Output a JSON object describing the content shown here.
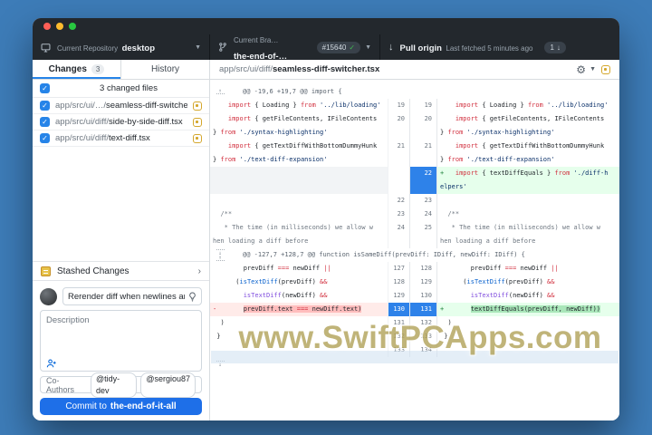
{
  "toolbar": {
    "repository": {
      "label": "Current Repository",
      "value": "desktop"
    },
    "branch": {
      "label": "Current Bra…",
      "value": "the-end-of-…",
      "badge": "#15640"
    },
    "pull": {
      "label": "Pull origin",
      "sublabel": "Last fetched 5 minutes ago",
      "badge": "1"
    }
  },
  "sidebar": {
    "tabs": {
      "changes": "Changes",
      "changes_badge": "3",
      "history": "History"
    },
    "files_header": "3 changed files",
    "files": [
      {
        "prefix": "app/src/ui/…/",
        "name": "seamless-diff-switcher.tsx",
        "checked": true,
        "status": "modified"
      },
      {
        "prefix": "app/src/ui/diff/",
        "name": "side-by-side-diff.tsx",
        "checked": true,
        "status": "modified"
      },
      {
        "prefix": "app/src/ui/diff/",
        "name": "text-diff.tsx",
        "checked": true,
        "status": "modified"
      }
    ],
    "stashed_label": "Stashed Changes",
    "commit": {
      "summary_value": "Rerender diff when newlines are adde",
      "description_placeholder": "Description",
      "coauthors_label": "Co-Authors",
      "coauthors": [
        "@tidy-dev",
        "@sergiou87"
      ],
      "button_prefix": "Commit to",
      "button_branch": "the-end-of-it-all"
    }
  },
  "diff": {
    "path_prefix": "app/src/ui/diff/",
    "file_name": "seamless-diff-switcher.tsx",
    "rows": [
      {
        "t": "hunk",
        "icons": [
          "up"
        ],
        "text": "@@ -19,6 +19,7 @@ import {"
      },
      {
        "t": "line",
        "old": "19",
        "new": "19",
        "lk": "ctx",
        "rk": "ctx",
        "l": [
          [
            "    ",
            "p"
          ],
          [
            "import",
            "k"
          ],
          [
            " { Loading } ",
            "p"
          ],
          [
            "from",
            "k"
          ],
          [
            " ",
            "p"
          ],
          [
            "'../lib/loading'",
            "s"
          ]
        ],
        "r": [
          [
            "    ",
            "p"
          ],
          [
            "import",
            "k"
          ],
          [
            " { Loading } ",
            "p"
          ],
          [
            "from",
            "k"
          ],
          [
            " ",
            "p"
          ],
          [
            "'../lib/loading'",
            "s"
          ]
        ]
      },
      {
        "t": "line",
        "old": "20",
        "new": "20",
        "lk": "ctx",
        "rk": "ctx",
        "l": [
          [
            "    ",
            "p"
          ],
          [
            "import",
            "k"
          ],
          [
            " { getFileContents, IFileContents\n} ",
            "p"
          ],
          [
            "from",
            "k"
          ],
          [
            " ",
            "p"
          ],
          [
            "'./syntax-highlighting'",
            "s"
          ]
        ],
        "r": [
          [
            "    ",
            "p"
          ],
          [
            "import",
            "k"
          ],
          [
            " { getFileContents, IFileContents\n} ",
            "p"
          ],
          [
            "from",
            "k"
          ],
          [
            " ",
            "p"
          ],
          [
            "'./syntax-highlighting'",
            "s"
          ]
        ]
      },
      {
        "t": "line",
        "old": "21",
        "new": "21",
        "lk": "ctx",
        "rk": "ctx",
        "l": [
          [
            "    ",
            "p"
          ],
          [
            "import",
            "k"
          ],
          [
            " { getTextDiffWithBottomDummyHunk\n} ",
            "p"
          ],
          [
            "from",
            "k"
          ],
          [
            " ",
            "p"
          ],
          [
            "'./text-diff-expansion'",
            "s"
          ]
        ],
        "r": [
          [
            "    ",
            "p"
          ],
          [
            "import",
            "k"
          ],
          [
            " { getTextDiffWithBottomDummyHunk\n} ",
            "p"
          ],
          [
            "from",
            "k"
          ],
          [
            " ",
            "p"
          ],
          [
            "'./text-diff-expansion'",
            "s"
          ]
        ]
      },
      {
        "t": "line",
        "old": "",
        "new": "22",
        "nsel": true,
        "lk": "ph",
        "rk": "add",
        "rm": "+",
        "l": [],
        "r": [
          [
            "    ",
            "p"
          ],
          [
            "import",
            "k"
          ],
          [
            " { textDiffEquals } ",
            "p"
          ],
          [
            "from",
            "k"
          ],
          [
            " ",
            "p"
          ],
          [
            "'./diff-h\nelpers'",
            "s"
          ]
        ]
      },
      {
        "t": "line",
        "old": "22",
        "new": "23",
        "lk": "ctx",
        "rk": "ctx",
        "l": [],
        "r": []
      },
      {
        "t": "line",
        "old": "23",
        "new": "24",
        "lk": "ctx",
        "rk": "ctx",
        "l": [
          [
            "  ",
            "p"
          ],
          [
            "/**",
            "c"
          ]
        ],
        "r": [
          [
            "  ",
            "p"
          ],
          [
            "/**",
            "c"
          ]
        ]
      },
      {
        "t": "line",
        "old": "24",
        "new": "25",
        "lk": "ctx",
        "rk": "ctx",
        "l": [
          [
            "   ",
            "p"
          ],
          [
            "* The time (in milliseconds) we allow w\nhen loading a diff before",
            "c"
          ]
        ],
        "r": [
          [
            "   ",
            "p"
          ],
          [
            "* The time (in milliseconds) we allow w\nhen loading a diff before",
            "c"
          ]
        ]
      },
      {
        "t": "hunk",
        "icons": [
          "down",
          "up"
        ],
        "text": "@@ -127,7 +128,7 @@ function isSameDiff(prevDiff: IDiff, newDiff: IDiff) {"
      },
      {
        "t": "line",
        "old": "127",
        "new": "128",
        "lk": "ctx",
        "rk": "ctx",
        "l": [
          [
            "        ",
            "p"
          ],
          [
            "prevDiff ",
            "p"
          ],
          [
            "===",
            "k"
          ],
          [
            " newDiff ",
            "p"
          ],
          [
            "||",
            "k"
          ]
        ],
        "r": [
          [
            "        ",
            "p"
          ],
          [
            "prevDiff ",
            "p"
          ],
          [
            "===",
            "k"
          ],
          [
            " newDiff ",
            "p"
          ],
          [
            "||",
            "k"
          ]
        ]
      },
      {
        "t": "line",
        "old": "128",
        "new": "129",
        "lk": "ctx",
        "rk": "ctx",
        "l": [
          [
            "      ",
            "p"
          ],
          [
            "(",
            "p"
          ],
          [
            "isTextDiff",
            "b"
          ],
          [
            "(prevDiff) ",
            "p"
          ],
          [
            "&&",
            "k"
          ]
        ],
        "r": [
          [
            "      ",
            "p"
          ],
          [
            "(",
            "p"
          ],
          [
            "isTextDiff",
            "b"
          ],
          [
            "(prevDiff) ",
            "p"
          ],
          [
            "&&",
            "k"
          ]
        ]
      },
      {
        "t": "line",
        "old": "129",
        "new": "130",
        "lk": "ctx",
        "rk": "ctx",
        "l": [
          [
            "        ",
            "p"
          ],
          [
            "isTextDiff",
            "f"
          ],
          [
            "(newDiff) ",
            "p"
          ],
          [
            "&&",
            "k"
          ]
        ],
        "r": [
          [
            "        ",
            "p"
          ],
          [
            "isTextDiff",
            "f"
          ],
          [
            "(newDiff) ",
            "p"
          ],
          [
            "&&",
            "k"
          ]
        ]
      },
      {
        "t": "line",
        "old": "130",
        "new": "131",
        "osel": true,
        "nsel": true,
        "lk": "del",
        "rk": "add",
        "lm": "-",
        "rm": "+",
        "l": [
          [
            "        ",
            "p"
          ],
          [
            "prevDiff.text ",
            "p",
            "h"
          ],
          [
            "===",
            "k",
            "h"
          ],
          [
            " newDiff.text)",
            "p",
            "h"
          ]
        ],
        "r": [
          [
            "        ",
            "p"
          ],
          [
            "textDiffEquals(prevDiff, newDiff))",
            "p",
            "h"
          ]
        ]
      },
      {
        "t": "line",
        "old": "131",
        "new": "132",
        "lk": "ctx",
        "rk": "ctx",
        "l": [
          [
            "  ",
            "p"
          ],
          [
            ")",
            "p"
          ]
        ],
        "r": [
          [
            "  ",
            "p"
          ],
          [
            ")",
            "p"
          ]
        ]
      },
      {
        "t": "line",
        "old": "132",
        "new": "133",
        "lk": "ctx",
        "rk": "ctx",
        "l": [
          [
            " ",
            "p"
          ],
          [
            "}",
            "p"
          ]
        ],
        "r": [
          [
            " ",
            "p"
          ],
          [
            "}",
            "p"
          ]
        ]
      },
      {
        "t": "line",
        "old": "133",
        "new": "134",
        "lk": "ctx",
        "rk": "ctx",
        "l": [],
        "r": []
      },
      {
        "t": "expand",
        "icons": [
          "down"
        ]
      }
    ]
  },
  "watermark": "www.SwiftPCApps.com",
  "colors": {
    "accent_blue": "#2684e8",
    "selected_line_number": "#2e82e9",
    "added_bg": "#e6ffec",
    "removed_bg": "#ffebe9",
    "modified_icon": "#d4a72c",
    "success_green": "#3fb950",
    "desktop_bg": "#3d7cb8",
    "toolbar_bg": "#23282d"
  }
}
